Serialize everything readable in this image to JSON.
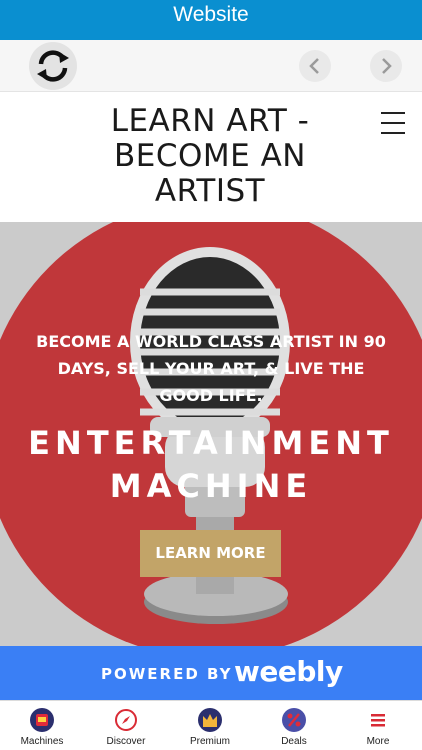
{
  "window": {
    "title": "Website"
  },
  "navbar": {
    "refresh_icon": "refresh-icon",
    "back_icon": "chevron-left-icon",
    "forward_icon": "chevron-right-icon"
  },
  "site": {
    "title": "LEARN ART - BECOME AN ARTIST",
    "menu_icon": "hamburger-menu-icon"
  },
  "hero": {
    "tagline": "BECOME A WORLD CLASS ARTIST IN 90 DAYS, SELL YOUR ART, & LIVE THE GOOD LIFE.",
    "heading_line1": "ENTERTAINMENT",
    "heading_line2": "MACHINE",
    "button_label": "LEARN MORE",
    "image": "microphone-image",
    "colors": {
      "circle": "#c0373a",
      "background": "#cbcbcb",
      "button": "#c2a468"
    }
  },
  "footer_banner": {
    "label": "POWERED BY",
    "logo_text": "weebly",
    "color": "#3a7ff5"
  },
  "tabbar": {
    "tabs": [
      {
        "label": "Machines",
        "icon": "slot-machine-icon"
      },
      {
        "label": "Discover",
        "icon": "compass-icon"
      },
      {
        "label": "Premium",
        "icon": "crown-icon"
      },
      {
        "label": "Deals",
        "icon": "percent-icon"
      },
      {
        "label": "More",
        "icon": "menu-icon"
      }
    ]
  },
  "colors": {
    "titlebar": "#0a8fd0",
    "accent_red": "#d92b35"
  }
}
